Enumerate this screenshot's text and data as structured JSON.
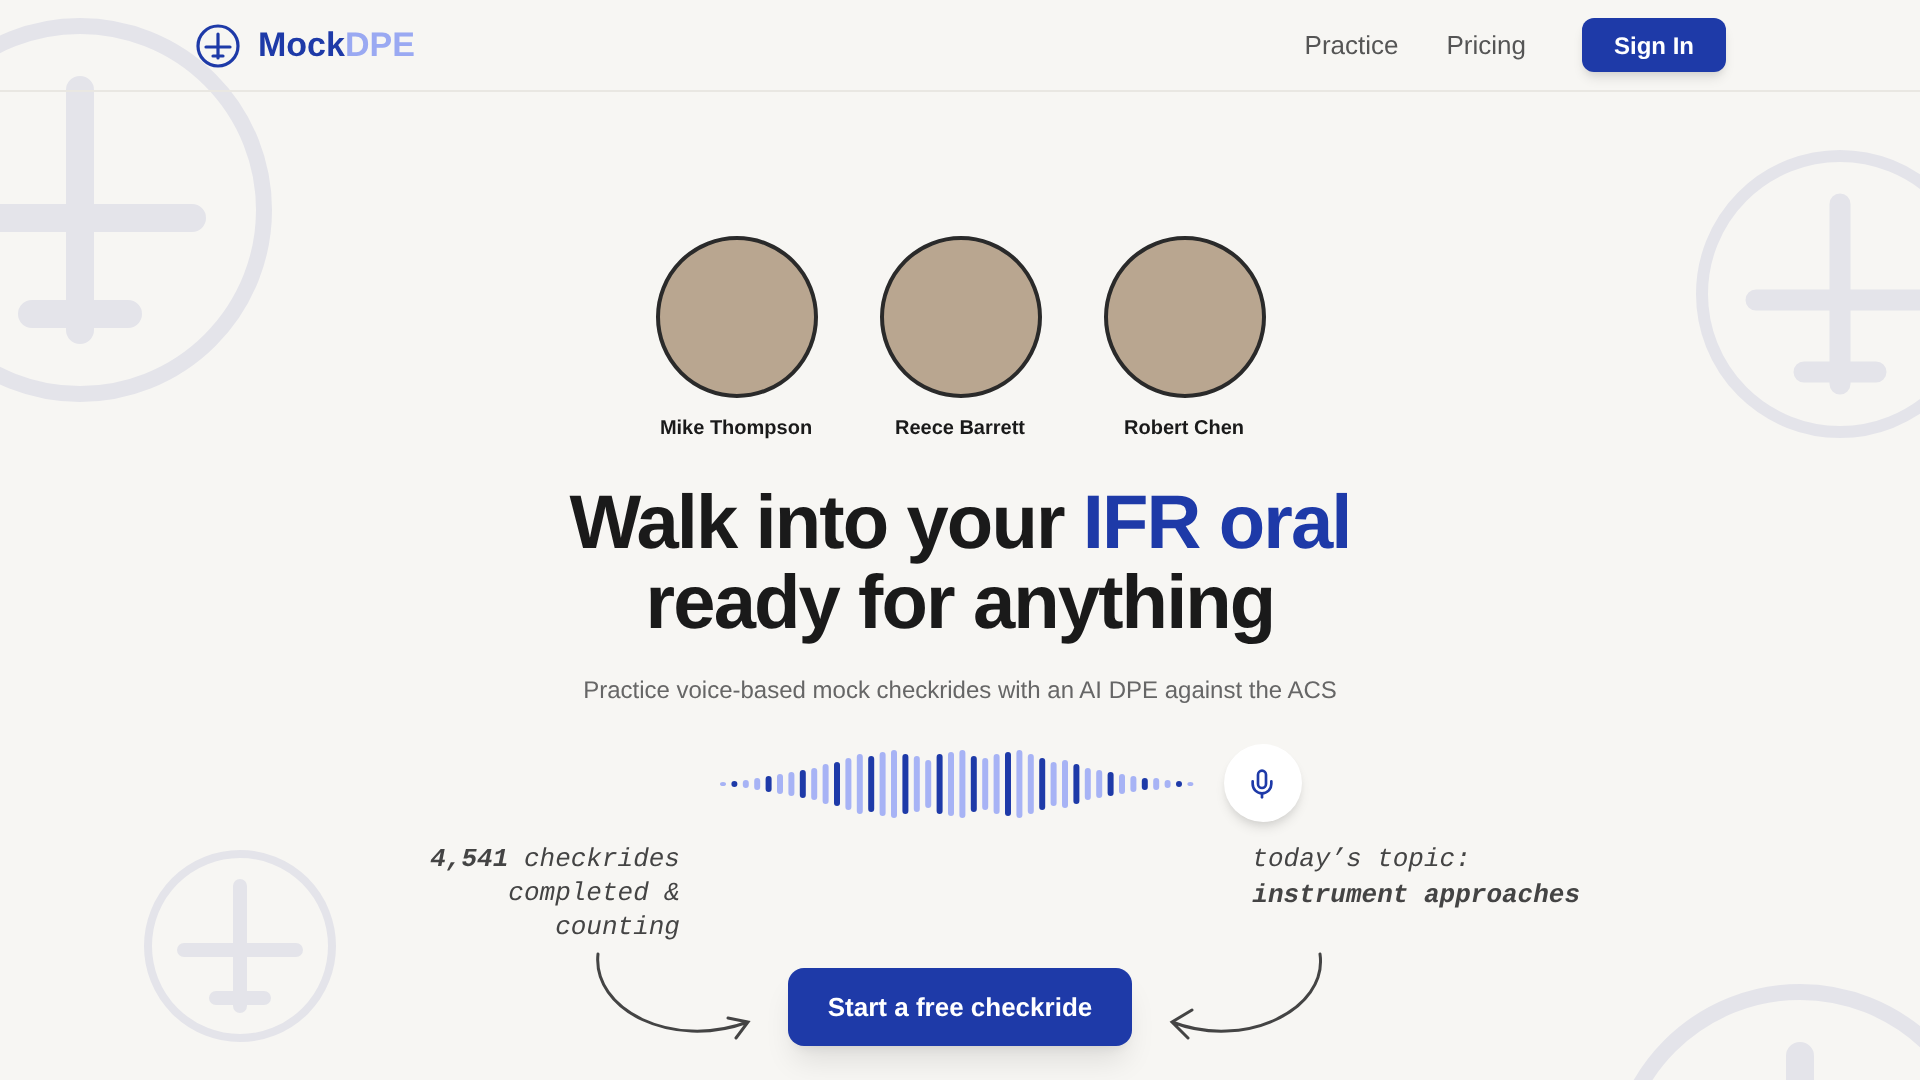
{
  "brand": {
    "part_1": "Mock",
    "part_2": "DPE"
  },
  "nav": {
    "links": [
      "Practice",
      "Pricing"
    ],
    "sign_in": "Sign In"
  },
  "examiners": [
    {
      "name": "Mike Thompson"
    },
    {
      "name": "Reece Barrett"
    },
    {
      "name": "Robert Chen"
    }
  ],
  "headline": {
    "start": "Walk into your",
    "highlight": "IFR oral",
    "line_2": "ready for anything"
  },
  "subtitle": "Practice voice-based mock checkrides with an AI DPE against the ACS",
  "note_left": "**4,541** checkrides completed & counting",
  "note_right": {
    "line_1": "today’s topic:",
    "line_2": "instrument approaches"
  },
  "cta": "Start a free checkride"
}
